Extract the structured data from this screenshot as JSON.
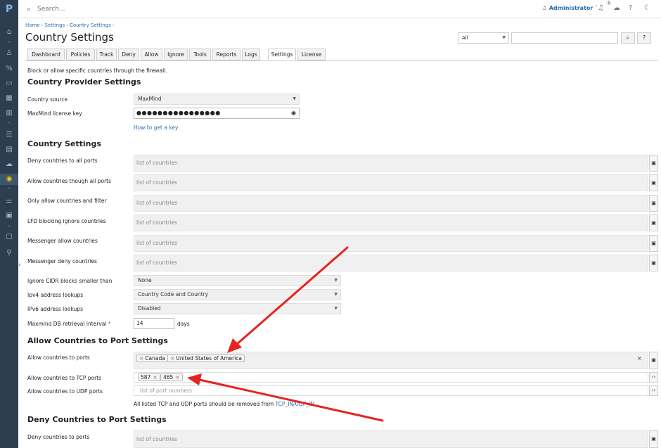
{
  "sidebar": {
    "logo": "P",
    "icons": [
      "home-icon",
      "user-icon",
      "percent-icon",
      "monitor-icon",
      "grid-icon",
      "book-icon",
      "list-icon",
      "package-icon",
      "cloud-icon",
      "shield-icon",
      "sliders-icon",
      "apps-icon",
      "briefcase-icon",
      "wrench-icon"
    ],
    "glyphs": [
      "⌂",
      "♙",
      "%",
      "▭",
      "▦",
      "▥",
      "☰",
      "▤",
      "☁",
      "◉",
      "⚌",
      "▣",
      "☐",
      "⚲"
    ],
    "expand": "›"
  },
  "topbar": {
    "search_placeholder": "Search...",
    "user_label": "Administrator",
    "notification_count": "1"
  },
  "breadcrumb": [
    "Home",
    "Settings",
    "Country Settings"
  ],
  "page_title": "Country Settings",
  "filter": {
    "select_value": "All",
    "search_button": "⌕",
    "help_button": "?"
  },
  "tabs": [
    "Dashboard",
    "Policies",
    "Track",
    "Deny",
    "Allow",
    "Ignore",
    "Tools",
    "Reports",
    "Logs",
    "Settings",
    "License"
  ],
  "active_tab": "Settings",
  "description": "Block or allow specific countries through the firewall.",
  "provider": {
    "heading": "Country Provider Settings",
    "source_label": "Country source",
    "source_value": "MaxMind",
    "license_label": "MaxMind license key",
    "license_value": "●●●●●●●●●●●●●●●●",
    "get_key_link": "How to get a key"
  },
  "country": {
    "heading": "Country Settings",
    "rows": [
      {
        "label": "Deny countries to all ports",
        "placeholder": "list of countries"
      },
      {
        "label": "Allow countries though all ports",
        "placeholder": "list of countries"
      },
      {
        "label": "Only allow countries and filter",
        "placeholder": "list of countries"
      },
      {
        "label": "LFD blocking ignore countries",
        "placeholder": "list of countries"
      },
      {
        "label": "Messenger allow countries",
        "placeholder": "list of countries"
      },
      {
        "label": "Messenger deny countries",
        "placeholder": "list of countries"
      }
    ],
    "cidr_label": "Ignore CIDR blocks smaller than",
    "cidr_value": "None",
    "ipv4_label": "Ipv4 address lookups",
    "ipv4_value": "Country Code and Country",
    "ipv6_label": "IPv6 address lookups",
    "ipv6_value": "Disabled",
    "interval_label": "Maxmind DB retrieval interval",
    "interval_value": "14",
    "interval_unit": "days"
  },
  "allow_ports": {
    "heading": "Allow Countries to Port Settings",
    "ports_label": "Allow countries to ports",
    "countries": [
      "Canada",
      "United States of America"
    ],
    "tcp_label": "Allow countries to TCP ports",
    "tcp_ports": [
      "587",
      "465"
    ],
    "udp_label": "Allow countries to UDP ports",
    "udp_placeholder": "list of port numbers",
    "note_prefix": "All listed TCP and UDP ports should be removed from",
    "note_link": "TCP_IN/UDP_IN"
  },
  "deny_ports": {
    "heading": "Deny Countries to Port Settings",
    "ports_label": "Deny countries to ports",
    "placeholder": "list of countries"
  },
  "colors": {
    "sidebar": "#2c3e50",
    "link": "#2a6db0",
    "arrow": "#e52420"
  }
}
